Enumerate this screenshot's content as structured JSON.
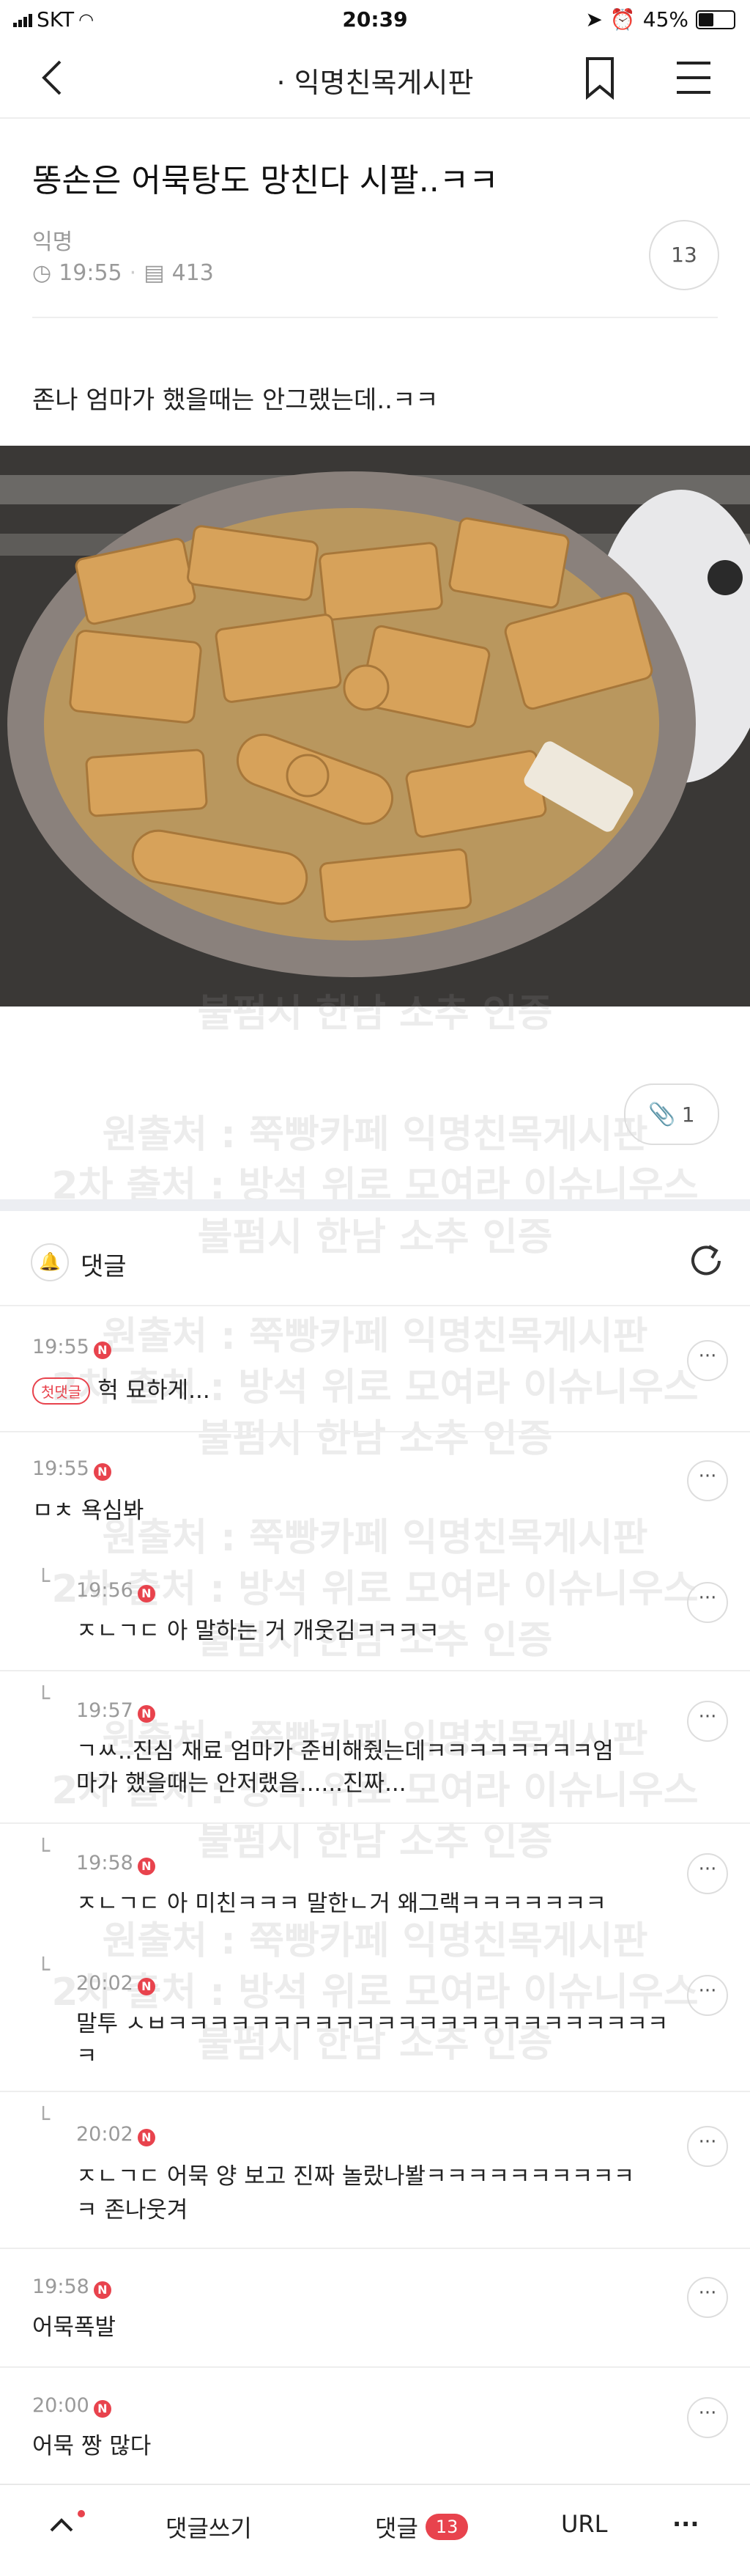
{
  "status_bar": {
    "carrier": "SKT",
    "time": "20:39",
    "battery": "45%"
  },
  "nav": {
    "board_title": "· 익명친목게시판"
  },
  "post": {
    "title": "똥손은 어묵탕도 망친다 시팔..ㅋㅋ",
    "author": "익명",
    "time": "19:55",
    "views": "413",
    "comment_count": "13",
    "body": "존나 엄마가 했을때는 안그랬는데..ㅋㅋ",
    "attachment_count": "1"
  },
  "watermark": {
    "line1": "원출처 : 쭉빵카페 익명친목게시판",
    "line2": "2차 출처 : 방석 위로 모여라 이슈니우스",
    "line3": "불펌시 한남 소추 인증"
  },
  "comments_header": {
    "label": "댓글"
  },
  "comments": [
    {
      "time": "19:55",
      "badge": "N",
      "tag": "첫댓글",
      "text": "헉 묘하게...",
      "reply": false
    },
    {
      "time": "19:55",
      "badge": "N",
      "text": "ㅁㅊ 욕심봐",
      "reply": false
    },
    {
      "time": "19:56",
      "badge": "N",
      "text": "ㅈㄴㄱㄷ 아 말하는 거 개웃김ㅋㅋㅋㅋ",
      "reply": true
    },
    {
      "time": "19:57",
      "badge": "N",
      "text_line1": "ㄱㅆ..진심 재료 엄마가 준비해줬는데ㅋㅋㅋㅋㅋㅋㅋㅋ엄",
      "text_line2": "마가 했을때는 안저랬음......진짜...",
      "reply": true
    },
    {
      "time": "19:58",
      "badge": "N",
      "text": "ㅈㄴㄱㄷ 아 미친ㅋㅋㅋ 말한ㄴ거 왜그랙ㅋㅋㅋㅋㅋㅋㅋ",
      "reply": true
    },
    {
      "time": "20:02",
      "badge": "N",
      "text_line1": "말투 ㅅㅂㅋㅋㅋㅋㅋㅋㅋㅋㅋㅋㅋㅋㅋㅋㅋㅋㅋㅋㅋㅋㅋㅋㅋㅋ",
      "text_line2": "ㅋ",
      "reply": true
    },
    {
      "time": "20:02",
      "badge": "N",
      "text_line1": "ㅈㄴㄱㄷ 어묵 양 보고 진짜 놀랐나봘ㅋㅋㅋㅋㅋㅋㅋㅋㅋㅋ",
      "text_line2": "ㅋ 존나웃겨",
      "reply": true
    },
    {
      "time": "19:58",
      "badge": "N",
      "text": "어묵폭발",
      "reply": false
    },
    {
      "time": "20:00",
      "badge": "N",
      "text": "어묵 짱 많다",
      "reply": false
    }
  ],
  "bottom_bar": {
    "write_label": "댓글쓰기",
    "comments_label": "댓글",
    "comments_count": "13",
    "url_label": "URL",
    "more_label": "···"
  },
  "colors": {
    "accent": "#e8434d"
  }
}
